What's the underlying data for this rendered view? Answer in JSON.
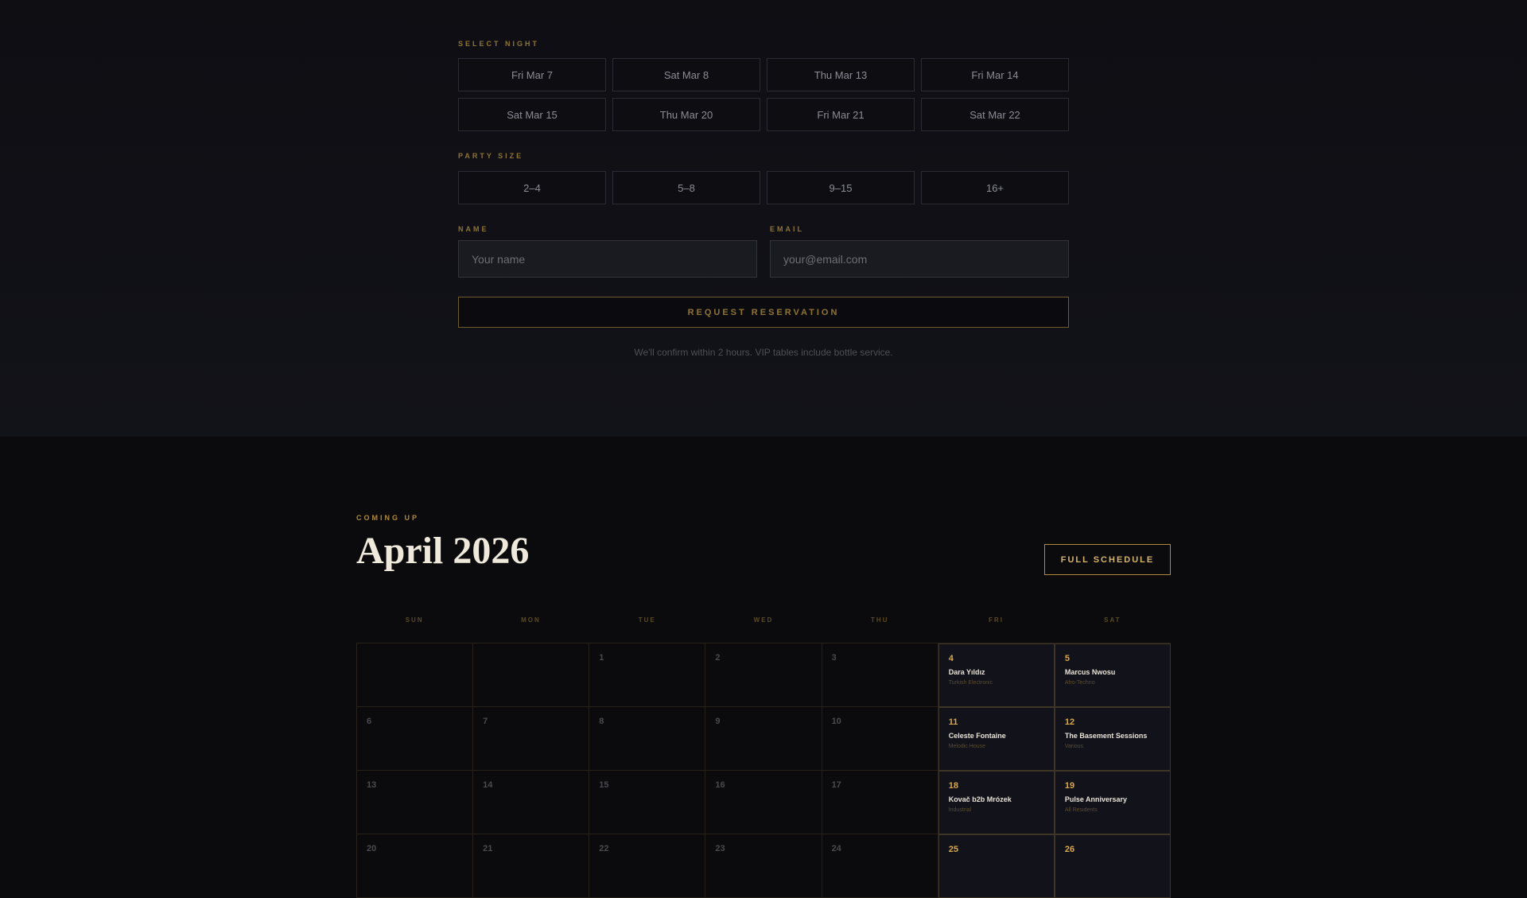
{
  "reservation": {
    "select_night_label": "SELECT NIGHT",
    "nights": [
      "Fri Mar 7",
      "Sat Mar 8",
      "Thu Mar 13",
      "Fri Mar 14",
      "Sat Mar 15",
      "Thu Mar 20",
      "Fri Mar 21",
      "Sat Mar 22"
    ],
    "party_size_label": "PARTY SIZE",
    "party_sizes": [
      "2–4",
      "5–8",
      "9–15",
      "16+"
    ],
    "name_label": "NAME",
    "name_placeholder": "Your name",
    "email_label": "EMAIL",
    "email_placeholder": "your@email.com",
    "submit_label": "REQUEST RESERVATION",
    "note": "We'll confirm within 2 hours. VIP tables include bottle service."
  },
  "calendar": {
    "eyebrow": "COMING UP",
    "title": "April 2026",
    "full_schedule_label": "FULL SCHEDULE",
    "weekdays": [
      "SUN",
      "MON",
      "TUE",
      "WED",
      "THU",
      "FRI",
      "SAT"
    ],
    "cells": [
      {
        "day": ""
      },
      {
        "day": ""
      },
      {
        "day": "1"
      },
      {
        "day": "2"
      },
      {
        "day": "3"
      },
      {
        "day": "4",
        "title": "Dara Yıldız",
        "genre": "Turkish Electronic"
      },
      {
        "day": "5",
        "title": "Marcus Nwosu",
        "genre": "Afro-Techno"
      },
      {
        "day": "6"
      },
      {
        "day": "7"
      },
      {
        "day": "8"
      },
      {
        "day": "9"
      },
      {
        "day": "10"
      },
      {
        "day": "11",
        "title": "Celeste Fontaine",
        "genre": "Melodic House"
      },
      {
        "day": "12",
        "title": "The Basement Sessions",
        "genre": "Various"
      },
      {
        "day": "13"
      },
      {
        "day": "14"
      },
      {
        "day": "15"
      },
      {
        "day": "16"
      },
      {
        "day": "17"
      },
      {
        "day": "18",
        "title": "Kovač b2b Mrózek",
        "genre": "Industrial"
      },
      {
        "day": "19",
        "title": "Pulse Anniversary",
        "genre": "All Residents"
      },
      {
        "day": "20"
      },
      {
        "day": "21"
      },
      {
        "day": "22"
      },
      {
        "day": "23"
      },
      {
        "day": "24"
      },
      {
        "day": "25",
        "title": "",
        "genre": ""
      },
      {
        "day": "26",
        "title": "",
        "genre": ""
      }
    ]
  },
  "colors": {
    "accent_gold": "#b08a3a",
    "event_day_gold": "#d9a84a",
    "background": "#0b0b0d"
  }
}
